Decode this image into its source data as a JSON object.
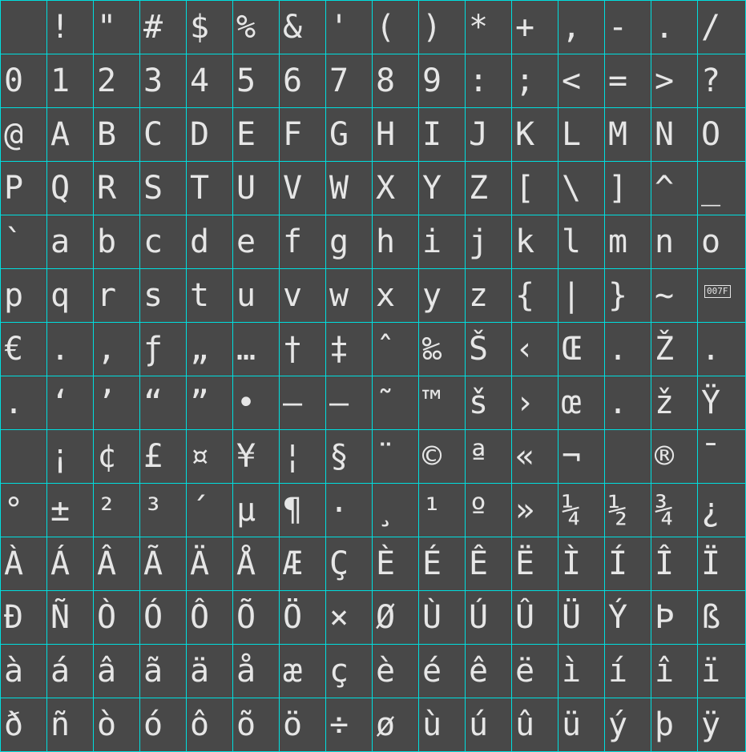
{
  "grid": {
    "rows": [
      [
        " ",
        "!",
        "\"",
        "#",
        "$",
        "%",
        "&",
        "'",
        "(",
        ")",
        "*",
        "+",
        ",",
        "-",
        ".",
        "/"
      ],
      [
        "0",
        "1",
        "2",
        "3",
        "4",
        "5",
        "6",
        "7",
        "8",
        "9",
        ":",
        ";",
        "<",
        "=",
        ">",
        "?"
      ],
      [
        "@",
        "A",
        "B",
        "C",
        "D",
        "E",
        "F",
        "G",
        "H",
        "I",
        "J",
        "K",
        "L",
        "M",
        "N",
        "O"
      ],
      [
        "P",
        "Q",
        "R",
        "S",
        "T",
        "U",
        "V",
        "W",
        "X",
        "Y",
        "Z",
        "[",
        "\\",
        "]",
        "^",
        "_"
      ],
      [
        "`",
        "a",
        "b",
        "c",
        "d",
        "e",
        "f",
        "g",
        "h",
        "i",
        "j",
        "k",
        "l",
        "m",
        "n",
        "o"
      ],
      [
        "p",
        "q",
        "r",
        "s",
        "t",
        "u",
        "v",
        "w",
        "x",
        "y",
        "z",
        "{",
        "|",
        "}",
        "~",
        "007F"
      ],
      [
        "€",
        ".",
        ",",
        "ƒ",
        "„",
        "…",
        "†",
        "‡",
        "ˆ",
        "‰",
        "Š",
        "‹",
        "Œ",
        ".",
        "Ž",
        "."
      ],
      [
        ".",
        "‘",
        "’",
        "“",
        "”",
        "•",
        "–",
        "—",
        "˜",
        "™",
        "š",
        "›",
        "œ",
        ".",
        "ž",
        "Ÿ"
      ],
      [
        " ",
        "¡",
        "¢",
        "£",
        "¤",
        "¥",
        "¦",
        "§",
        "¨",
        "©",
        "ª",
        "«",
        "¬",
        " ",
        "®",
        "¯"
      ],
      [
        "°",
        "±",
        "²",
        "³",
        "´",
        "µ",
        "¶",
        "·",
        "¸",
        "¹",
        "º",
        "»",
        "¼",
        "½",
        "¾",
        "¿"
      ],
      [
        "À",
        "Á",
        "Â",
        "Ã",
        "Ä",
        "Å",
        "Æ",
        "Ç",
        "È",
        "É",
        "Ê",
        "Ë",
        "Ì",
        "Í",
        "Î",
        "Ï"
      ],
      [
        "Ð",
        "Ñ",
        "Ò",
        "Ó",
        "Ô",
        "Õ",
        "Ö",
        "×",
        "Ø",
        "Ù",
        "Ú",
        "Û",
        "Ü",
        "Ý",
        "Þ",
        "ß"
      ],
      [
        "à",
        "á",
        "â",
        "ã",
        "ä",
        "å",
        "æ",
        "ç",
        "è",
        "é",
        "ê",
        "ë",
        "ì",
        "í",
        "î",
        "ï"
      ],
      [
        "ð",
        "ñ",
        "ò",
        "ó",
        "ô",
        "õ",
        "ö",
        "÷",
        "ø",
        "ù",
        "ú",
        "û",
        "ü",
        "ý",
        "þ",
        "ÿ"
      ]
    ]
  },
  "colors": {
    "background": "#484848",
    "gridline": "#00dede",
    "glyph": "#e6e6e6"
  }
}
